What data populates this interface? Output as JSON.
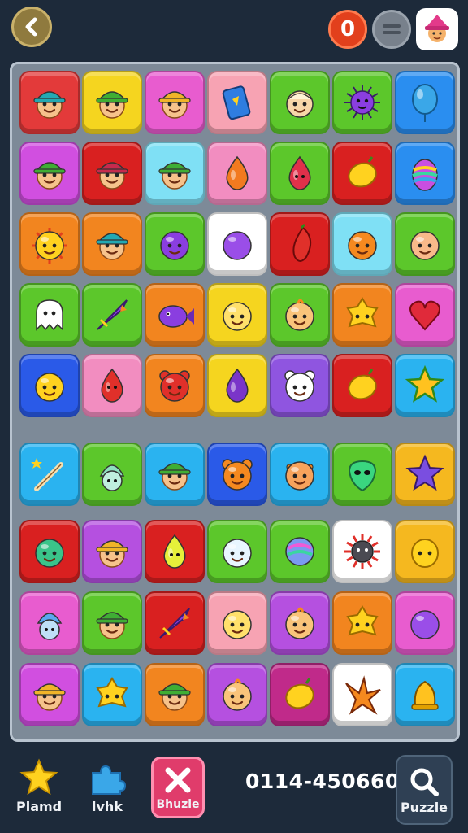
{
  "topbar": {
    "score": "0",
    "back_icon": "chevron-left-icon",
    "menu_icon": "menu-icon",
    "avatar_icon": "wizard-avatar-icon"
  },
  "board": {
    "tiles": [
      {
        "color": "#e33a3a",
        "icon": "boy-teal-hat"
      },
      {
        "color": "#f5d51f",
        "icon": "boy-green-hat"
      },
      {
        "color": "#e85ccf",
        "icon": "boy-yellow-hat"
      },
      {
        "color": "#f7a3b3",
        "icon": "card"
      },
      {
        "color": "#5cc72b",
        "icon": "boy-bald"
      },
      {
        "color": "#5cc72b",
        "icon": "spiky-virus"
      },
      {
        "color": "#2a8ef0",
        "icon": "balloon"
      },
      {
        "color": "#d14fe0",
        "icon": "boy-green-hat"
      },
      {
        "color": "#d92020",
        "icon": "boy-red-hat"
      },
      {
        "color": "#7fe0f5",
        "icon": "boy-green-hat"
      },
      {
        "color": "#f28dc0",
        "icon": "drop-orange"
      },
      {
        "color": "#5cc72b",
        "icon": "drop-red"
      },
      {
        "color": "#d92020",
        "icon": "lemon"
      },
      {
        "color": "#2a8ef0",
        "icon": "egg-rainbow"
      },
      {
        "color": "#f2851f",
        "icon": "sun-face"
      },
      {
        "color": "#f2851f",
        "icon": "boy-teal-hat"
      },
      {
        "color": "#5cc72b",
        "icon": "plum"
      },
      {
        "color": "#ffffff",
        "icon": "purple-blob"
      },
      {
        "color": "#d92020",
        "icon": "chili"
      },
      {
        "color": "#7fe0f5",
        "icon": "orange-face"
      },
      {
        "color": "#5cc72b",
        "icon": "peach-face"
      },
      {
        "color": "#5cc72b",
        "icon": "ghost"
      },
      {
        "color": "#5cc72b",
        "icon": "dart"
      },
      {
        "color": "#f2851f",
        "icon": "purple-fish"
      },
      {
        "color": "#f5d51f",
        "icon": "happy-face"
      },
      {
        "color": "#5cc72b",
        "icon": "chick"
      },
      {
        "color": "#f2851f",
        "icon": "yellow-blob"
      },
      {
        "color": "#e85ccf",
        "icon": "heart-balloon"
      },
      {
        "color": "#2a5ae8",
        "icon": "yellow-face"
      },
      {
        "color": "#f28dc0",
        "icon": "red-fish"
      },
      {
        "color": "#f2851f",
        "icon": "red-bear"
      },
      {
        "color": "#f5d51f",
        "icon": "purple-drop"
      },
      {
        "color": "#8f55e0",
        "icon": "white-bear"
      },
      {
        "color": "#d92020",
        "icon": "lemon"
      },
      {
        "color": "#2ab3f0",
        "icon": "star-gold"
      },
      {
        "color": "#2ab3f0",
        "icon": "wand"
      },
      {
        "color": "#5cc72b",
        "icon": "gnome-green"
      },
      {
        "color": "#2ab3f0",
        "icon": "boy-green-hat"
      },
      {
        "color": "#2a5ae8",
        "icon": "orange-bear"
      },
      {
        "color": "#2ab3f0",
        "icon": "orange-head"
      },
      {
        "color": "#5cc72b",
        "icon": "green-alien"
      },
      {
        "color": "#f5b81f",
        "icon": "star-purple"
      },
      {
        "color": "#d92020",
        "icon": "green-face"
      },
      {
        "color": "#b550e0",
        "icon": "boy-yellow-hat"
      },
      {
        "color": "#d92020",
        "icon": "lime-drop"
      },
      {
        "color": "#5cc72b",
        "icon": "snow-face"
      },
      {
        "color": "#5cc72b",
        "icon": "rainbow-orb"
      },
      {
        "color": "#ffffff",
        "icon": "sun-dark"
      },
      {
        "color": "#f5b81f",
        "icon": "lemon-face"
      },
      {
        "color": "#e85ccf",
        "icon": "gnome-blue"
      },
      {
        "color": "#5cc72b",
        "icon": "boy-green-hat"
      },
      {
        "color": "#d92020",
        "icon": "dart"
      },
      {
        "color": "#f7a3b3",
        "icon": "happy-face"
      },
      {
        "color": "#b550e0",
        "icon": "chick"
      },
      {
        "color": "#f2851f",
        "icon": "yellow-blob"
      },
      {
        "color": "#e85ccf",
        "icon": "purple-blob"
      },
      {
        "color": "#d14fe0",
        "icon": "boy-yellow-hat"
      },
      {
        "color": "#2ab3f0",
        "icon": "yellow-blob"
      },
      {
        "color": "#f2851f",
        "icon": "boy-green-hat"
      },
      {
        "color": "#b550e0",
        "icon": "chick"
      },
      {
        "color": "#c02a8a",
        "icon": "lemon"
      },
      {
        "color": "#ffffff",
        "icon": "starfish"
      },
      {
        "color": "#2ab3f0",
        "icon": "bell-yellow"
      }
    ]
  },
  "bottombar": {
    "star_label": "Plamd",
    "link_label": "lvhk",
    "close_label": "Bhuzle",
    "code": "0114-450660",
    "puzzle_label": "Puzzle"
  }
}
